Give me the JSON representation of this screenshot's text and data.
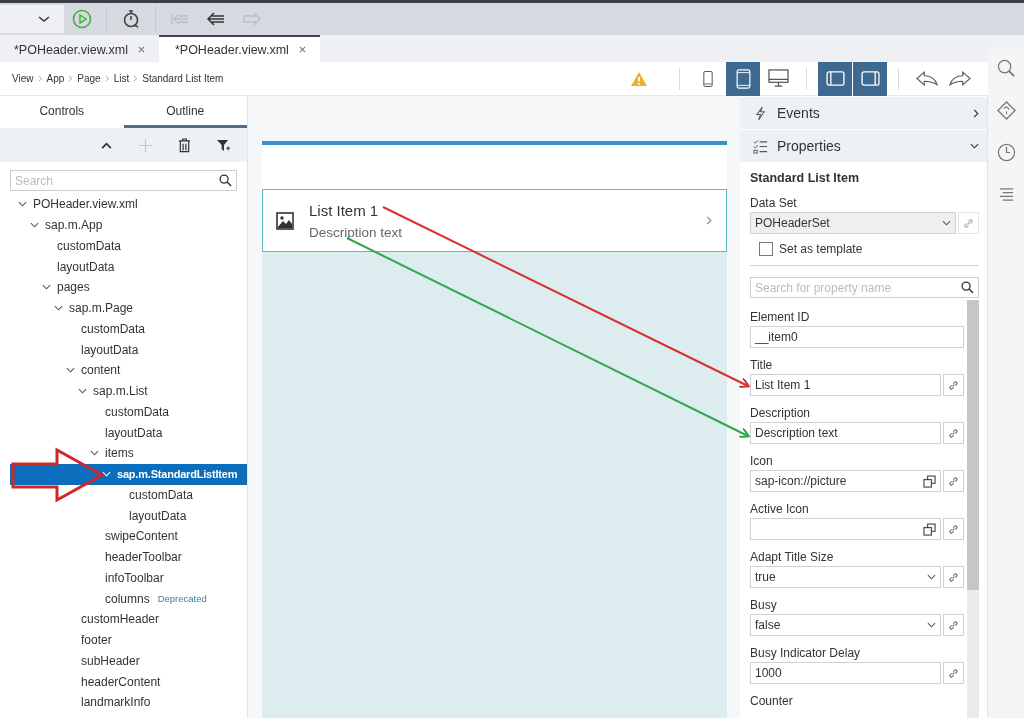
{
  "toolbar": {
    "history_buttons": [
      {
        "kind": "first",
        "disabled": true
      },
      {
        "kind": "back",
        "disabled": false
      },
      {
        "kind": "forward",
        "disabled": true
      }
    ]
  },
  "editor_tabs": [
    {
      "label": "*POHeader.view.xml",
      "selected": false
    },
    {
      "label": "*POHeader.view.xml",
      "selected": true
    }
  ],
  "breadcrumb": [
    "View",
    "App",
    "Page",
    "List",
    "Standard List Item"
  ],
  "device_buttons": [
    {
      "kind": "phone",
      "selected": false
    },
    {
      "kind": "tablet",
      "selected": true
    },
    {
      "kind": "desktop",
      "selected": false
    }
  ],
  "panel_toggles": [
    {
      "kind": "left",
      "selected": true
    },
    {
      "kind": "right",
      "selected": true
    }
  ],
  "left_panel": {
    "tabs": [
      {
        "label": "Controls",
        "selected": false
      },
      {
        "label": "Outline",
        "selected": true
      }
    ],
    "toolbar": [
      {
        "kind": "collapse",
        "disabled": false
      },
      {
        "kind": "add",
        "disabled": true
      },
      {
        "kind": "delete",
        "disabled": false
      },
      {
        "kind": "filter",
        "disabled": false
      }
    ],
    "search": {
      "placeholder": "Search"
    },
    "tree": [
      {
        "label": "POHeader.view.xml",
        "expanded": true,
        "selected": false,
        "children": [
          {
            "label": "sap.m.App",
            "expanded": true,
            "selected": false,
            "children": [
              {
                "label": "customData",
                "selected": false
              },
              {
                "label": "layoutData",
                "selected": false
              },
              {
                "label": "pages",
                "expanded": true,
                "selected": false,
                "children": [
                  {
                    "label": "sap.m.Page",
                    "expanded": true,
                    "selected": false,
                    "children": [
                      {
                        "label": "customData",
                        "selected": false
                      },
                      {
                        "label": "layoutData",
                        "selected": false
                      },
                      {
                        "label": "content",
                        "expanded": true,
                        "selected": false,
                        "children": [
                          {
                            "label": "sap.m.List",
                            "expanded": true,
                            "selected": false,
                            "children": [
                              {
                                "label": "customData",
                                "selected": false
                              },
                              {
                                "label": "layoutData",
                                "selected": false
                              },
                              {
                                "label": "items",
                                "expanded": true,
                                "selected": false,
                                "children": [
                                  {
                                    "label": "sap.m.StandardListItem",
                                    "expanded": true,
                                    "selected": true,
                                    "children": [
                                      {
                                        "label": "customData",
                                        "selected": false
                                      },
                                      {
                                        "label": "layoutData",
                                        "selected": false
                                      }
                                    ]
                                  }
                                ]
                              },
                              {
                                "label": "swipeContent",
                                "selected": false
                              },
                              {
                                "label": "headerToolbar",
                                "selected": false
                              },
                              {
                                "label": "infoToolbar",
                                "selected": false
                              },
                              {
                                "label": "columns",
                                "badge": "Deprecated",
                                "selected": false
                              }
                            ]
                          }
                        ]
                      },
                      {
                        "label": "customHeader",
                        "selected": false
                      },
                      {
                        "label": "footer",
                        "selected": false
                      },
                      {
                        "label": "subHeader",
                        "selected": false
                      },
                      {
                        "label": "headerContent",
                        "selected": false
                      },
                      {
                        "label": "landmarkInfo",
                        "selected": false
                      }
                    ]
                  }
                ]
              }
            ]
          }
        ]
      }
    ]
  },
  "canvas": {
    "list_item": {
      "title": "List Item 1",
      "description": "Description text"
    }
  },
  "right_panel": {
    "sections": [
      {
        "label": "Events",
        "expanded": false
      },
      {
        "label": "Properties",
        "expanded": true
      }
    ],
    "heading": "Standard List Item",
    "data_set": {
      "label": "Data Set",
      "value": "POHeaderSet"
    },
    "template": {
      "label": "Set as template",
      "checked": false
    },
    "search": {
      "placeholder": "Search for property name"
    },
    "properties": [
      {
        "label": "Element ID",
        "kind": "input",
        "value": "__item0",
        "bindable": false
      },
      {
        "label": "Title",
        "kind": "input",
        "value": "List Item 1",
        "bindable": true
      },
      {
        "label": "Description",
        "kind": "input",
        "value": "Description text",
        "bindable": true
      },
      {
        "label": "Icon",
        "kind": "value-help",
        "value": "sap-icon://picture",
        "bindable": true
      },
      {
        "label": "Active Icon",
        "kind": "value-help",
        "bindable": true
      },
      {
        "label": "Adapt Title Size",
        "kind": "select",
        "value": "true",
        "bindable": true
      },
      {
        "label": "Busy",
        "kind": "select",
        "value": "false",
        "bindable": true
      },
      {
        "label": "Busy Indicator Delay",
        "kind": "input",
        "value": "1000",
        "bindable": true
      },
      {
        "label": "Counter",
        "kind": "label"
      }
    ]
  }
}
